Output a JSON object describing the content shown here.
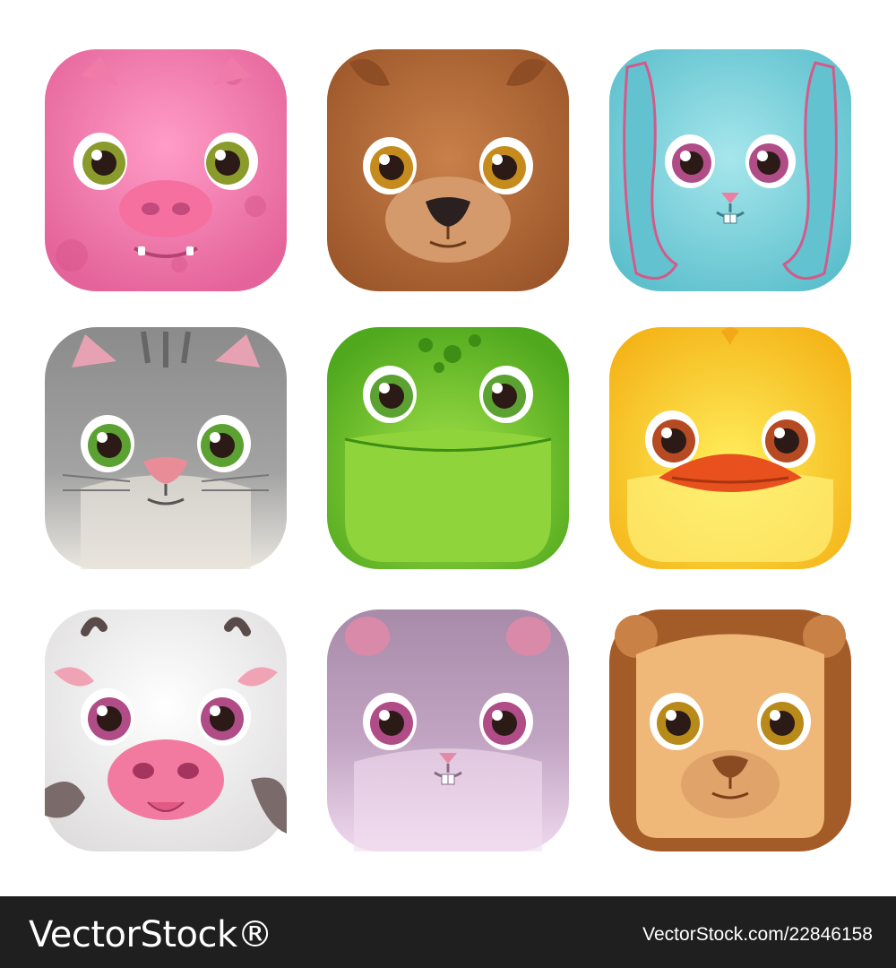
{
  "icons": [
    {
      "animal": "pig",
      "face_color": "#f27fae",
      "icon_name": "pig-face-icon"
    },
    {
      "animal": "bear",
      "face_color": "#b26a3a",
      "icon_name": "bear-face-icon"
    },
    {
      "animal": "bunny",
      "face_color": "#7fd3dc",
      "icon_name": "bunny-face-icon"
    },
    {
      "animal": "cat",
      "face_color": "#8f9090",
      "icon_name": "cat-face-icon"
    },
    {
      "animal": "frog",
      "face_color": "#6cc52a",
      "icon_name": "frog-face-icon"
    },
    {
      "animal": "duck",
      "face_color": "#f8c91c",
      "icon_name": "duck-face-icon"
    },
    {
      "animal": "cow",
      "face_color": "#f2f0f0",
      "icon_name": "cow-face-icon"
    },
    {
      "animal": "hamster",
      "face_color": "#b28fb4",
      "icon_name": "hamster-face-icon"
    },
    {
      "animal": "lion",
      "face_color": "#b0682f",
      "icon_name": "lion-face-icon"
    }
  ],
  "watermark": {
    "brand": "VectorStock®",
    "id_text": "VectorStock.com/22846158"
  }
}
